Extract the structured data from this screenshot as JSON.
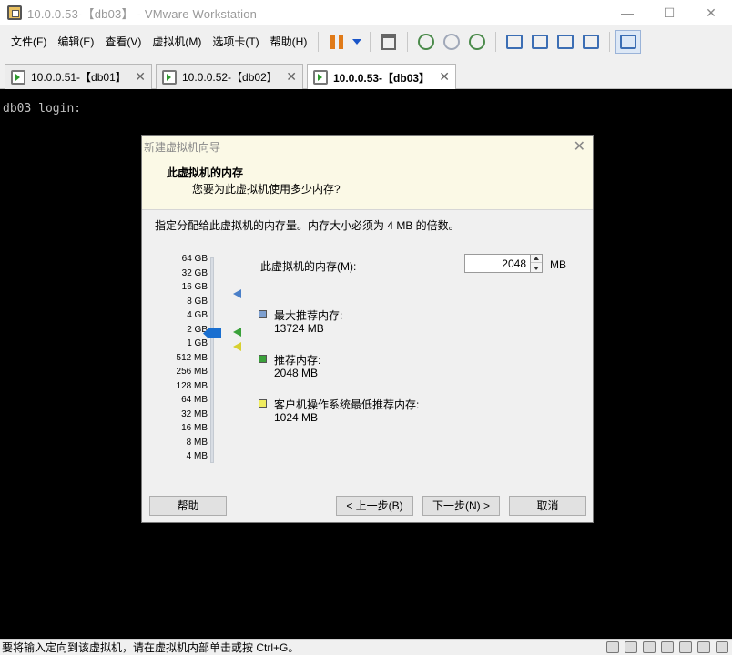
{
  "window": {
    "title": "10.0.0.53-【db03】 - VMware Workstation",
    "controls": [
      "—",
      "☐",
      "✕"
    ]
  },
  "menu": [
    "文件(F)",
    "编辑(E)",
    "查看(V)",
    "虚拟机(M)",
    "选项卡(T)",
    "帮助(H)"
  ],
  "tabs": [
    {
      "label": "10.0.0.51-【db01】",
      "active": false
    },
    {
      "label": "10.0.0.52-【db02】",
      "active": false
    },
    {
      "label": "10.0.0.53-【db03】",
      "active": true
    }
  ],
  "console": {
    "text": "db03 login:"
  },
  "dialog": {
    "title": "新建虚拟机向导",
    "heading": "此虚拟机的内存",
    "subheading": "您要为此虚拟机使用多少内存?",
    "description": "指定分配给此虚拟机的内存量。内存大小必须为 4 MB 的倍数。",
    "scale_labels": [
      "64 GB",
      "32 GB",
      "16 GB",
      "8 GB",
      "4 GB",
      "2 GB",
      "1 GB",
      "512 MB",
      "256 MB",
      "128 MB",
      "64 MB",
      "32 MB",
      "16 MB",
      "8 MB",
      "4 MB"
    ],
    "memory_label": "此虚拟机的内存(M):",
    "memory_value": "2048",
    "memory_unit": "MB",
    "max_recommended_title": "最大推荐内存:",
    "max_recommended_value": "13724 MB",
    "recommended_title": "推荐内存:",
    "recommended_value": "2048 MB",
    "guest_min_title": "客户机操作系统最低推荐内存:",
    "guest_min_value": "1024 MB",
    "buttons": {
      "help": "帮助",
      "back": "< 上一步(B)",
      "next": "下一步(N) >",
      "cancel": "取消"
    },
    "colors": {
      "max_recommended": "#7ea0d0",
      "recommended": "#3aa13a",
      "guest_min": "#f0ec60",
      "slider_thumb": "#1a6fd0"
    }
  },
  "statusbar": {
    "text": "要将输入定向到该虚拟机，请在虚拟机内部单击或按 Ctrl+G。"
  }
}
